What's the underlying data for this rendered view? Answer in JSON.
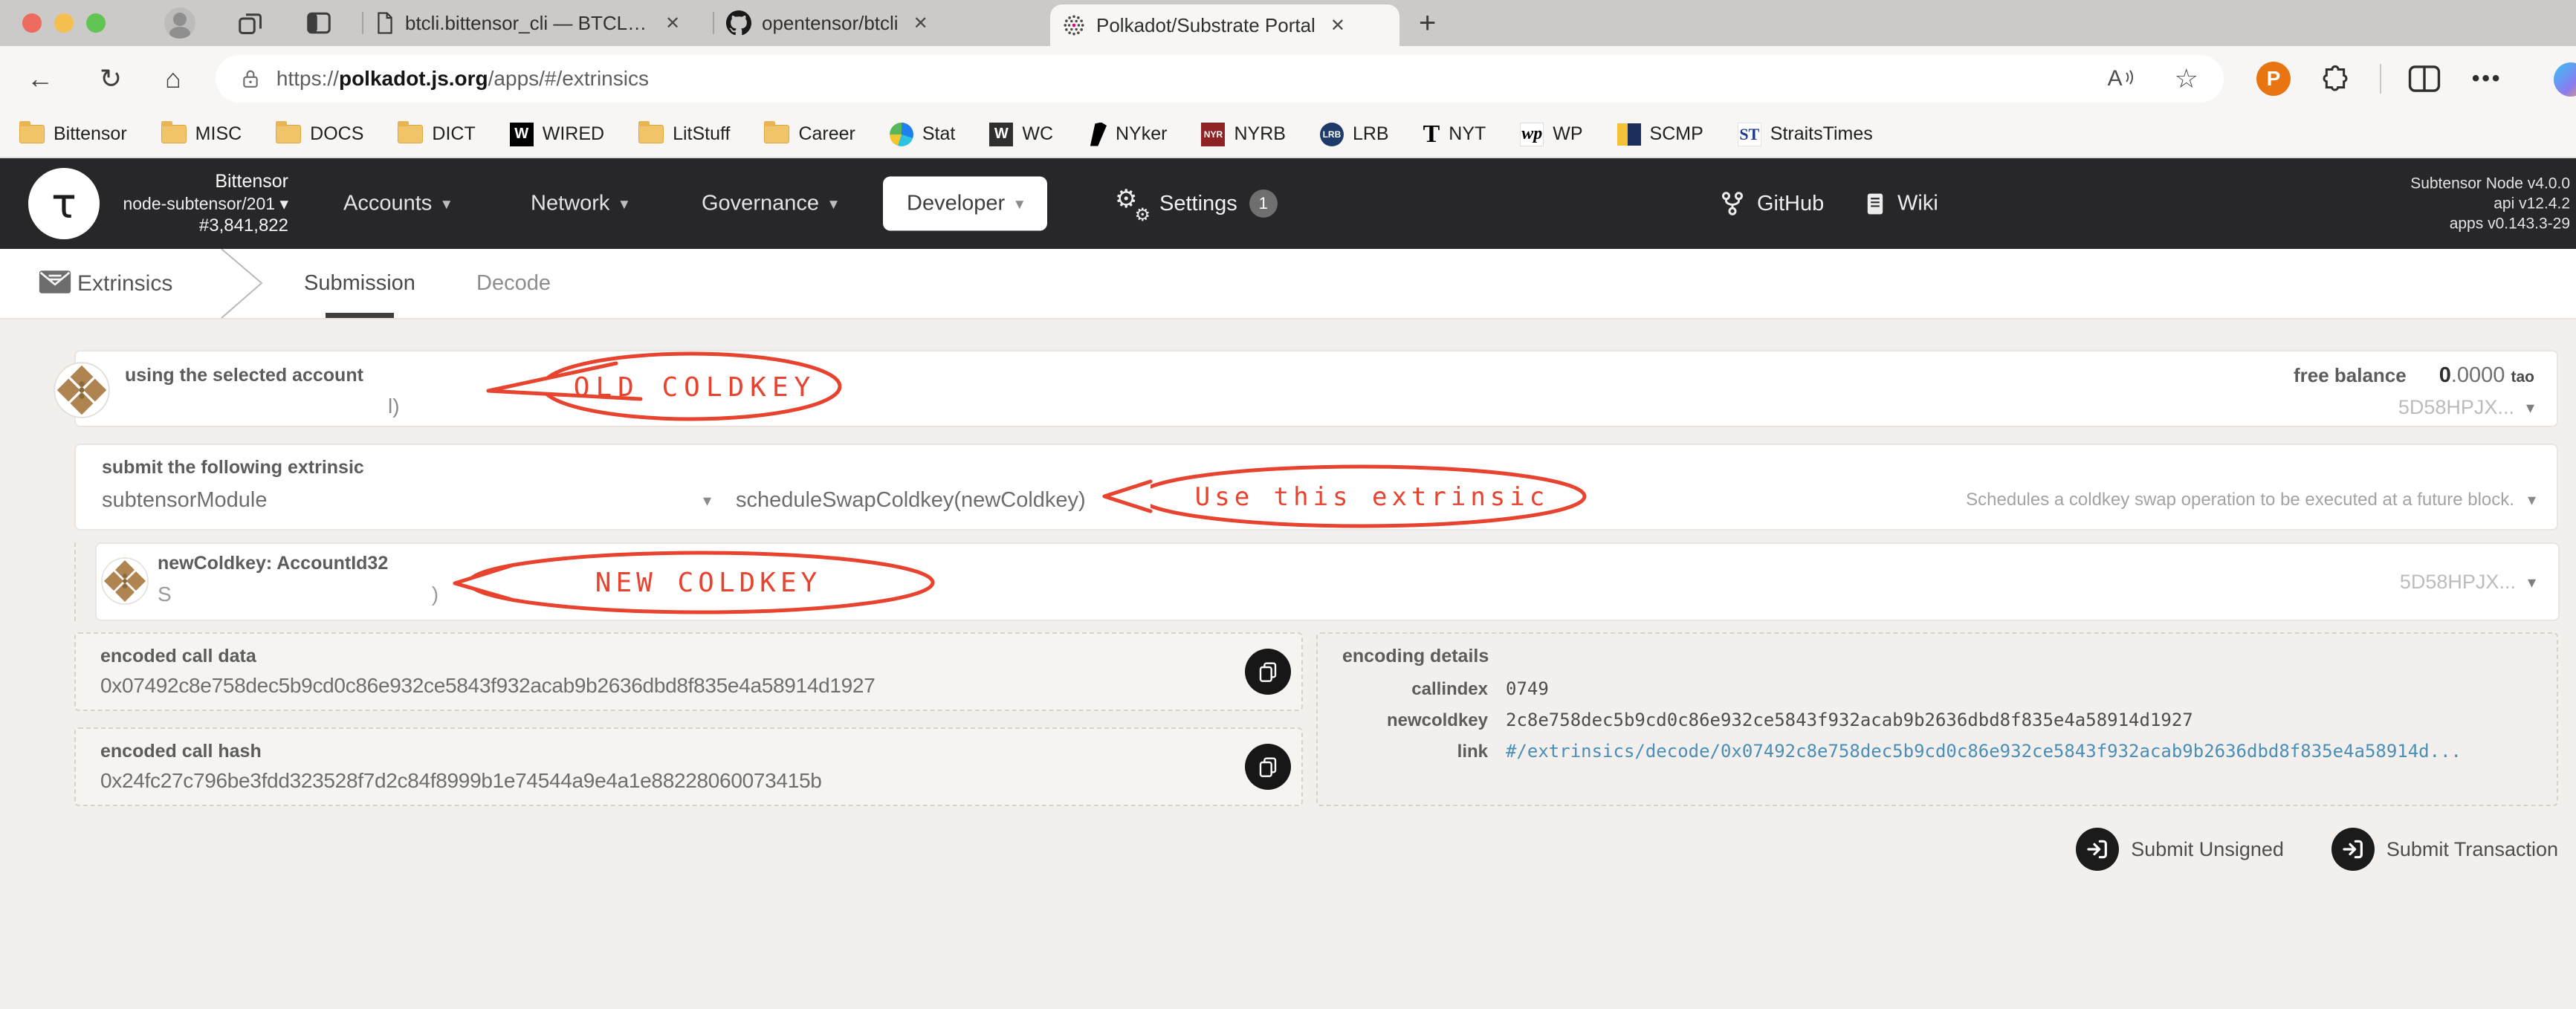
{
  "icons": {
    "close": "✕",
    "plus": "+",
    "back": "←",
    "reload": "↻",
    "home": "⌂",
    "read_aloud": "A",
    "star": "☆",
    "more": "•••",
    "caret": "▾",
    "gear": "⚙",
    "tau": "τ",
    "extension_p": "P"
  },
  "browser": {
    "tabs": [
      {
        "title": "btcli.bittensor_cli — BTCLI Docs"
      },
      {
        "title": "opentensor/btcli"
      },
      {
        "title": "Polkadot/Substrate Portal"
      }
    ],
    "url": {
      "protocol": "https://",
      "host": "polkadot.js.org",
      "path": "/apps/#/extrinsics"
    },
    "bookmark_icons": {
      "wired": "W",
      "wc": "W",
      "nyrb": "NYR",
      "lrb": "LRB",
      "nyt": "T",
      "wp": "wp",
      "straitstimes": "ST"
    },
    "bookmarks": [
      {
        "label": "Bittensor",
        "icon": "folder"
      },
      {
        "label": "MISC",
        "icon": "folder"
      },
      {
        "label": "DOCS",
        "icon": "folder"
      },
      {
        "label": "DICT",
        "icon": "folder"
      },
      {
        "label": "WIRED",
        "icon": "wired"
      },
      {
        "label": "LitStuff",
        "icon": "folder"
      },
      {
        "label": "Career",
        "icon": "folder"
      },
      {
        "label": "Stat",
        "icon": "stat"
      },
      {
        "label": "WC",
        "icon": "wc"
      },
      {
        "label": "NYker",
        "icon": "nyker"
      },
      {
        "label": "NYRB",
        "icon": "nyrb"
      },
      {
        "label": "LRB",
        "icon": "lrb"
      },
      {
        "label": "NYT",
        "icon": "nyt"
      },
      {
        "label": "WP",
        "icon": "wp"
      },
      {
        "label": "SCMP",
        "icon": "scmp"
      },
      {
        "label": "StraitsTimes",
        "icon": "straitstimes"
      }
    ]
  },
  "portal": {
    "header": {
      "chain": "Bittensor",
      "node": "node-subtensor/201",
      "block": "#3,841,822",
      "menu": [
        {
          "label": "Accounts"
        },
        {
          "label": "Network"
        },
        {
          "label": "Governance"
        },
        {
          "label": "Developer"
        }
      ],
      "settings_label": "Settings",
      "settings_badge": "1",
      "github_label": "GitHub",
      "wiki_label": "Wiki",
      "version_node": "Subtensor Node v4.0.0",
      "version_api": "api v12.4.2",
      "version_apps": "apps v0.143.3-29"
    },
    "nav": {
      "section": "Extrinsics",
      "tabs": [
        {
          "label": "Submission"
        },
        {
          "label": "Decode"
        }
      ]
    },
    "account_row": {
      "label": "using the selected account",
      "visible_fragment": "l)",
      "free_balance_label": "free balance",
      "balance_whole": "0",
      "balance_fraction": ".0000",
      "balance_unit": "tao",
      "address": "5D58HPJX..."
    },
    "extrinsic_row": {
      "label": "submit the following extrinsic",
      "module": "subtensorModule",
      "method": "scheduleSwapColdkey(newColdkey)",
      "description": "Schedules a coldkey swap operation to be executed at a future block."
    },
    "param_row": {
      "label": "newColdkey: AccountId32",
      "visible_start": "S",
      "visible_end": ")",
      "address": "5D58HPJX..."
    },
    "encoded_data": {
      "label": "encoded call data",
      "value": "0x07492c8e758dec5b9cd0c86e932ce5843f932acab9b2636dbd8f835e4a58914d1927"
    },
    "encoded_hash": {
      "label": "encoded call hash",
      "value": "0x24fc27c796be3fdd323528f7d2c84f8999b1e74544a9e4a1e88228060073415b"
    },
    "details": {
      "title": "encoding details",
      "rows": [
        {
          "label": "callindex",
          "value": "0749"
        },
        {
          "label": "newcoldkey",
          "value": "2c8e758dec5b9cd0c86e932ce5843f932acab9b2636dbd8f835e4a58914d1927"
        },
        {
          "label": "link",
          "value": "#/extrinsics/decode/0x07492c8e758dec5b9cd0c86e932ce5843f932acab9b2636dbd8f835e4a58914d..."
        }
      ]
    },
    "actions": [
      {
        "label": "Submit Unsigned"
      },
      {
        "label": "Submit Transaction"
      }
    ]
  },
  "annotations": [
    {
      "text": "OLD COLDKEY"
    },
    {
      "text": "Use this extrinsic"
    },
    {
      "text": "NEW COLDKEY"
    }
  ],
  "colors": {
    "annotation_red": "#e8432e",
    "link_blue": "#4a8fb7",
    "header_bg": "#27272a",
    "favicon_pink": "#e6007a"
  }
}
